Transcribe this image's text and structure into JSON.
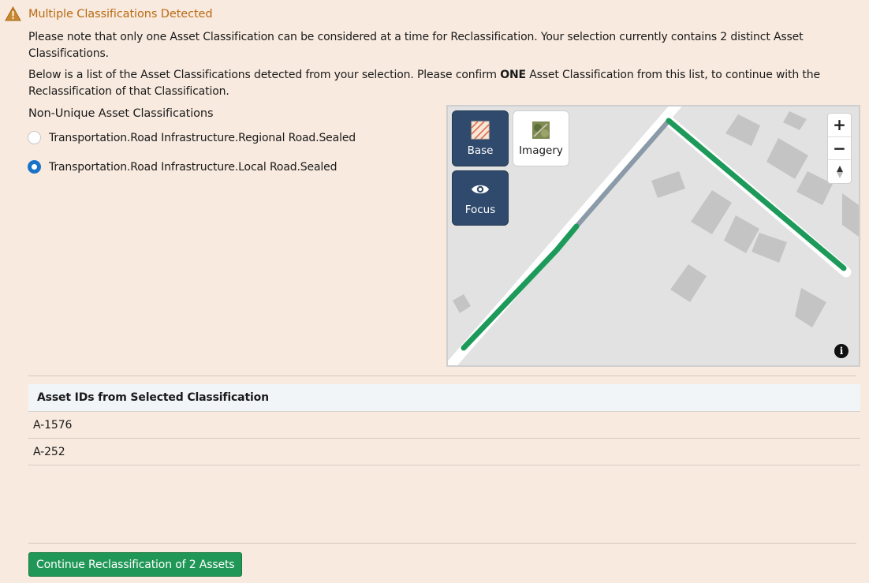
{
  "warning": {
    "icon": "warning-triangle-icon",
    "title": "Multiple Classifications Detected",
    "color": "#b86a14"
  },
  "notice": {
    "line1": "Please note that only one Asset Classification can be considered at a time for Reclassification. Your selection currently contains 2 distinct Asset Classifications.",
    "line2_before": "Below is a list of the Asset Classifications detected from your selection. Please confirm ",
    "line2_bold": "ONE",
    "line2_after": " Asset Classification from this list, to continue with the Reclassification of that Classification."
  },
  "classifications": {
    "heading": "Non-Unique Asset Classifications",
    "options": [
      {
        "label": "Transportation.Road Infrastructure.Regional Road.Sealed",
        "selected": false
      },
      {
        "label": "Transportation.Road Infrastructure.Local Road.Sealed",
        "selected": true
      }
    ]
  },
  "map": {
    "base_label": "Base",
    "imagery_label": "Imagery",
    "focus_label": "Focus",
    "zoom_in": "+",
    "zoom_out": "−",
    "info": "i",
    "colors": {
      "selected_road": "#1d9a5a",
      "other_road": "#8a9aa8",
      "buildings": "#c4c4c4",
      "background": "#e2e2e2"
    }
  },
  "asset_table": {
    "header": "Asset IDs from Selected Classification",
    "rows": [
      "A-1576",
      "A-252"
    ]
  },
  "actions": {
    "continue_label": "Continue Reclassification of 2 Assets",
    "continue_color": "#209757"
  }
}
